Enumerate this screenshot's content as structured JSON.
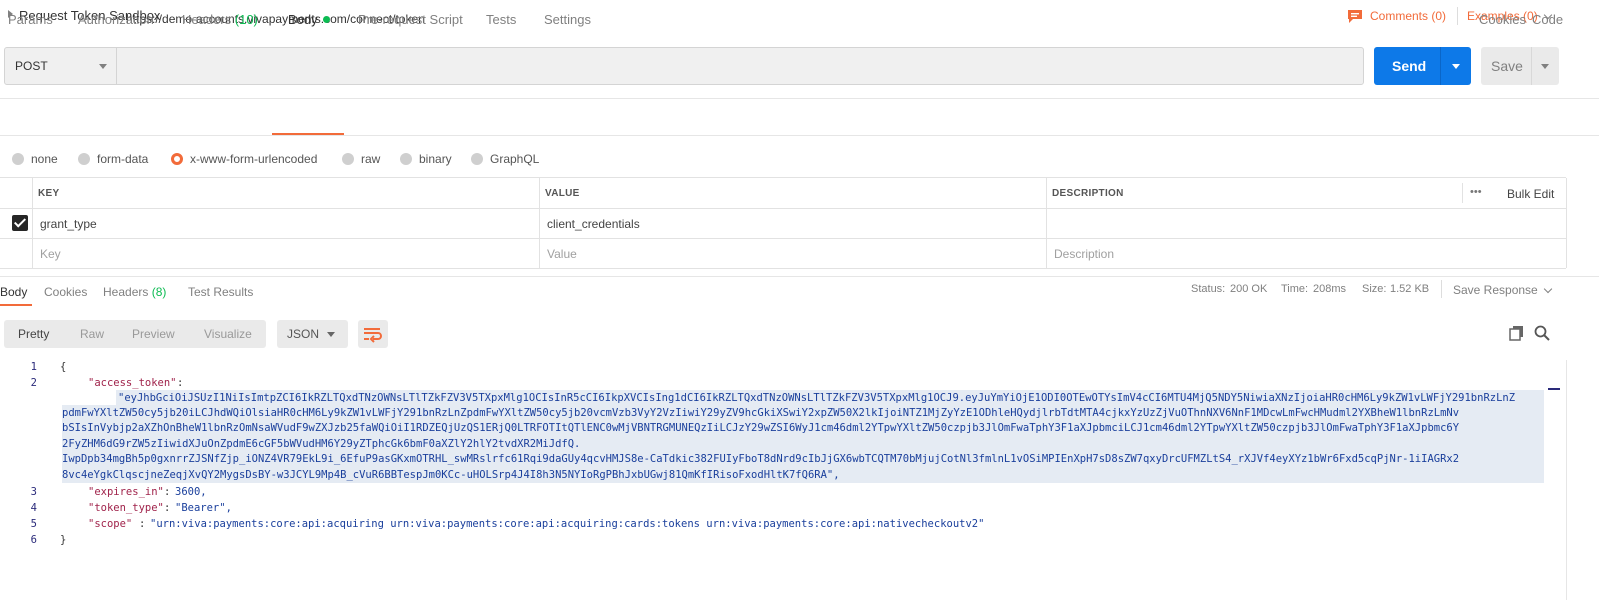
{
  "titlebar": {
    "title": "Request Token Sandbox",
    "comments": "Comments (0)",
    "examples": "Examples (0)"
  },
  "request": {
    "method": "POST",
    "url": "https://demo-accounts.vivapayments.com/connect/token",
    "send_label": "Send",
    "save_label": "Save"
  },
  "request_tabs": {
    "params": "Params",
    "authorization": "Authorization",
    "headers": "Headers",
    "headers_count": "(10)",
    "body": "Body",
    "prerequest": "Pre-request Script",
    "tests": "Tests",
    "settings": "Settings",
    "cookies": "Cookies",
    "code": "Code"
  },
  "body_types": {
    "none": "none",
    "form_data": "form-data",
    "urlencoded": "x-www-form-urlencoded",
    "raw": "raw",
    "binary": "binary",
    "graphql": "GraphQL",
    "selected": "x-www-form-urlencoded"
  },
  "params_table": {
    "headers": {
      "key": "KEY",
      "value": "VALUE",
      "description": "DESCRIPTION"
    },
    "more": "•••",
    "bulk_edit": "Bulk Edit",
    "rows": [
      {
        "key": "grant_type",
        "value": "client_credentials",
        "description": ""
      }
    ],
    "placeholders": {
      "key": "Key",
      "value": "Value",
      "description": "Description"
    }
  },
  "response_tabs": {
    "body": "Body",
    "cookies": "Cookies",
    "headers": "Headers",
    "headers_count": "(8)",
    "test_results": "Test Results"
  },
  "response_status": {
    "status_label": "Status:",
    "status_value": "200 OK",
    "time_label": "Time:",
    "time_value": "208ms",
    "size_label": "Size:",
    "size_value": "1.52 KB",
    "save_response": "Save Response"
  },
  "response_view": {
    "modes": [
      "Pretty",
      "Raw",
      "Preview",
      "Visualize"
    ],
    "active_mode": "Pretty",
    "format": "JSON"
  },
  "response_body": {
    "line_numbers": [
      "1",
      "2",
      "3",
      "4",
      "5",
      "6"
    ],
    "open_brace": "{",
    "close_brace": "}",
    "access_token_key": "\"access_token\"",
    "access_token_lines": [
      "\"eyJhbGciOiJSUzI1NiIsImtpZCI6IkRZLTQxdTNzOWNsLTlTZkFZV3V5TXpxMlg1OCIsInR5cCI6IkpXVCIsIng1dCI6IkRZLTQxdTNzOWNsLTlTZkFZV3V5TXpxMlg1OCJ9.eyJuYmYiOjE1ODI0OTEwOTYsImV4cCI6MTU4MjQ5NDY5NiwiaXNzIjoiaHR0cHM6Ly9kZW1vLWFjY291bnRzLnZ",
      "pdmFwYXltZW50cy5jb20iLCJhdWQiOlsiaHR0cHM6Ly9kZW1vLWFjY291bnRzLnZpdmFwYXltZW50cy5jb20vcmVzb3VyY2VzIiwiY29yZV9hcGkiXSwiY2xpZW50X2lkIjoiNTZ1MjZyYzE1ODhleHQydjlrbTdtMTA4cjkxYzUzZjVuOThnNXV6NnF1MDcwLmFwcHMudml2YXBheW1lbnRzLmNv",
      "bSIsInVybjp2aXZhOnBheW1lbnRzOmNsaWVudF9wZXJzb25faWQiOiI1RDZEQjUzQS1ERjQ0LTRFOTItQTlENC0wMjVBNTRGMUNEQzIiLCJzY29wZSI6WyJ1cm46dml2YTpwYXltZW50czpjb3JlOmFwaTphY3F1aXJpbmciLCJ1cm46dml2YTpwYXltZW50czpjb3JlOmFwaTphY3F1aXJpbmc6Y",
      "2FyZHM6dG9rZW5zIiwidXJuOnZpdmE6cGF5bWVudHM6Y29yZTphcGk6bmF0aXZlY2hlY2tvdXR2MiJdfQ.",
      "IwpDpb34mgBh5p0gxnrrZJSNfZjp_iONZ4VR79EkL9i_6EfuP9asGKxmOTRHL_swMRslrfc61Rqi9daGUy4qcvHMJS8e-CaTdkic382FUIyFboT8dNrd9cIbJjGX6wbTCQTM70bMjujCotNl3fmlnL1vOSiMPIEnXpH7sD8sZW7qxyDrcUFMZLtS4_rXJVf4eyXYz1bWr6Fxd5cqPjNr-1iIAGRx2",
      "8vc4eYgkClqscjneZeqjXvQY2MygsDsBY-w3JCYL9Mp4B_cVuR6BBTespJm0KCc-uHOLSrp4J4I8h3N5NYIoRgPBhJxbUGwj81QmKfIRisoFxodHltK7fQ6RA\""
    ],
    "expires_in_key": "\"expires_in\"",
    "expires_in_value": "3600",
    "token_type_key": "\"token_type\"",
    "token_type_value": "\"Bearer\"",
    "scope_key": "\"scope\"",
    "scope_value": "\"urn:viva:payments:core:api:acquiring urn:viva:payments:core:api:acquiring:cards:tokens urn:viva:payments:core:api:nativecheckoutv2\""
  },
  "colors": {
    "accent": "#f26b3a",
    "send_blue": "#0d79e8",
    "status_green": "#0cbb52"
  },
  "icons": [
    "comment-icon",
    "chevron-down-icon",
    "wrap-lines-icon",
    "copy-icon",
    "search-icon",
    "more-icon"
  ]
}
